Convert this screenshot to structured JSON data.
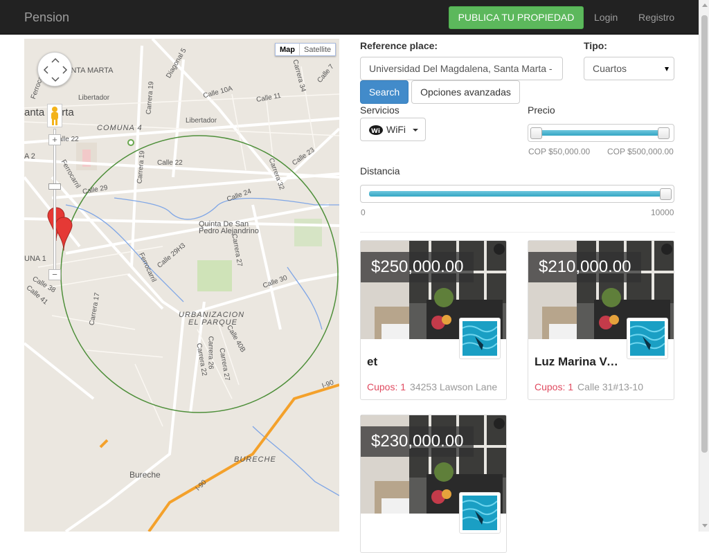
{
  "navbar": {
    "brand": "Pension",
    "publish_label": "PUBLICA TU PROPIEDAD",
    "login_label": "Login",
    "register_label": "Registro"
  },
  "map": {
    "map_type_active": "Map",
    "map_type_other": "Satellite",
    "zoom_in": "+",
    "zoom_out": "−",
    "labels": {
      "santa_marta_1": "ANTA MARTA",
      "santa_marta_2": "anta Marta",
      "ferrocarril_1": "Ferrocarril",
      "libertador_1": "Libertador",
      "libertador_2": "Libertador",
      "comuna4": "COMUNA 4",
      "carrera19_1": "Carrera 19",
      "carrera19_2": "Carrera 19",
      "diagonal5": "Diagonal 5",
      "calle10a": "Calle 10A",
      "calle11": "Calle 11",
      "carrera34": "Carrera 34",
      "calle7": "Calle 7",
      "calle22_1": "Calle 22",
      "calle22_2": "Calle 22",
      "calle23": "Calle 23",
      "carrera32": "Carrera 32",
      "calle24": "Calle 24",
      "calle29": "Calle 29",
      "ferrocarril_2": "Ferrocarril",
      "ferrocarril_3": "Ferrocarril",
      "carrera27_1": "Carrera 27",
      "quinta_1": "Quinta De San",
      "quinta_2": "Pedro Alejandrino",
      "calle29h3": "Calle 29H3",
      "calle30": "Calle 30",
      "urbanizacion_1": "URBANIZACION",
      "urbanizacion_2": "EL PARQUE",
      "calle40b": "Calle 40B",
      "carrera26": "Carrera 26",
      "carrera22": "Carrera 22",
      "carrera27_2": "Carrera 27",
      "carrera17": "Carrera 17",
      "calle38": "Calle 38",
      "calle41": "Calle 41",
      "comuna1": "UNA 1",
      "a2": "A 2",
      "i90_1": "I-90",
      "i90_2": "I-90",
      "bureche_1": "BURECHE",
      "bureche_2": "Bureche"
    }
  },
  "search": {
    "reference_label": "Reference place:",
    "reference_value": "Universidad Del Magdalena, Santa Marta - ",
    "tipo_label": "Tipo:",
    "tipo_value": "Cuartos",
    "search_label": "Search",
    "advanced_label": "Opciones avanzadas",
    "servicios_label": "Servicios",
    "servicios_value": "WiFi",
    "wifi_icon_text": "Wi",
    "precio_label": "Precio",
    "precio_min": "COP $50,000.00",
    "precio_max": "COP $500,000.00",
    "precio_range_fraction": [
      0.0,
      1.0
    ],
    "distancia_label": "Distancia",
    "distancia_min": "0",
    "distancia_max": "10000",
    "distancia_fraction": 1.0
  },
  "listings": [
    {
      "price": "$250,000.00",
      "title": "et",
      "cupos_label": "Cupos: 1",
      "address": "34253 Lawson Lane"
    },
    {
      "price": "$210,000.00",
      "title": "Luz Marina Vasquez",
      "cupos_label": "Cupos: 1",
      "address": "Calle 31#13-10"
    },
    {
      "price": "$230,000.00",
      "title": "",
      "cupos_label": "",
      "address": ""
    }
  ],
  "colors": {
    "navbar": "#222222",
    "publish": "#5cb85c",
    "primary": "#428bca",
    "slider": "#34a6c3",
    "cupos": "#e04a5f",
    "highway": "#f4a12b",
    "radius": "#4e8f3a"
  }
}
